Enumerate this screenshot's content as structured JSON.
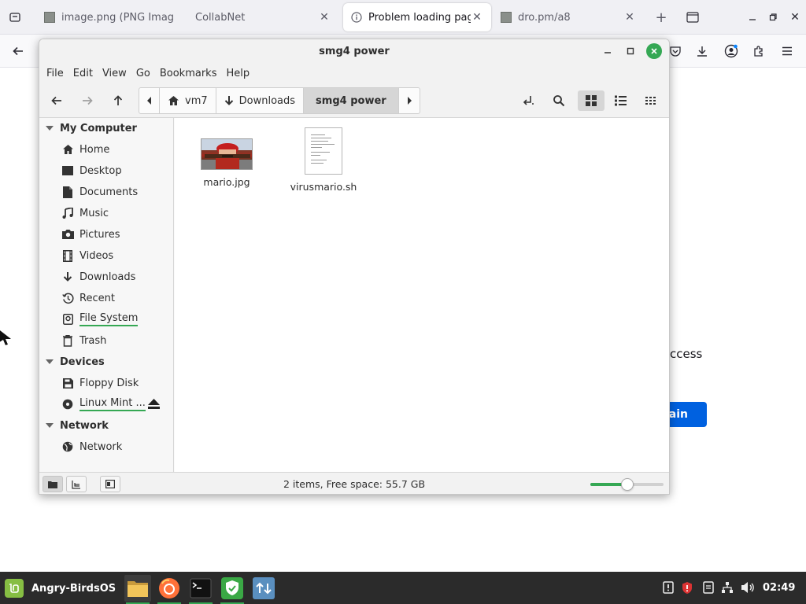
{
  "browser": {
    "tabs": [
      {
        "label": "image.png (PNG Imag",
        "icon": "image-icon",
        "active": false
      },
      {
        "label": "CollabNet",
        "icon": "none",
        "active": false
      },
      {
        "label": "Problem loading page",
        "icon": "info-icon",
        "active": true
      },
      {
        "label": "dro.pm/a8",
        "icon": "image-icon",
        "active": false
      }
    ],
    "error_text_fragment": "ccess",
    "error_button_fragment": "ain",
    "accent": "#0061e0"
  },
  "filemanager": {
    "title": "smg4 power",
    "menu": [
      "File",
      "Edit",
      "View",
      "Go",
      "Bookmarks",
      "Help"
    ],
    "breadcrumb": [
      {
        "label": "vm7",
        "icon": "home-icon"
      },
      {
        "label": "Downloads",
        "icon": "download-icon"
      },
      {
        "label": "smg4 power",
        "icon": "none",
        "current": true
      }
    ],
    "sidebar": {
      "sections": [
        {
          "title": "My Computer",
          "items": [
            "Home",
            "Desktop",
            "Documents",
            "Music",
            "Pictures",
            "Videos",
            "Downloads",
            "Recent",
            "File System",
            "Trash"
          ]
        },
        {
          "title": "Devices",
          "items": [
            "Floppy Disk",
            "Linux Mint ..."
          ]
        },
        {
          "title": "Network",
          "items": [
            "Network"
          ]
        }
      ]
    },
    "files": [
      {
        "name": "mario.jpg",
        "type": "image"
      },
      {
        "name": "virusmario.sh",
        "type": "script"
      }
    ],
    "status": "2 items, Free space: 55.7 GB",
    "zoom_level": 0.5,
    "accent": "#35a854"
  },
  "taskbar": {
    "start_label": "Angry-BirdsOS",
    "apps": [
      "file-manager-icon",
      "firefox-icon",
      "terminal-icon",
      "shield-app-icon",
      "update-manager-icon"
    ],
    "clock": "02:49"
  }
}
